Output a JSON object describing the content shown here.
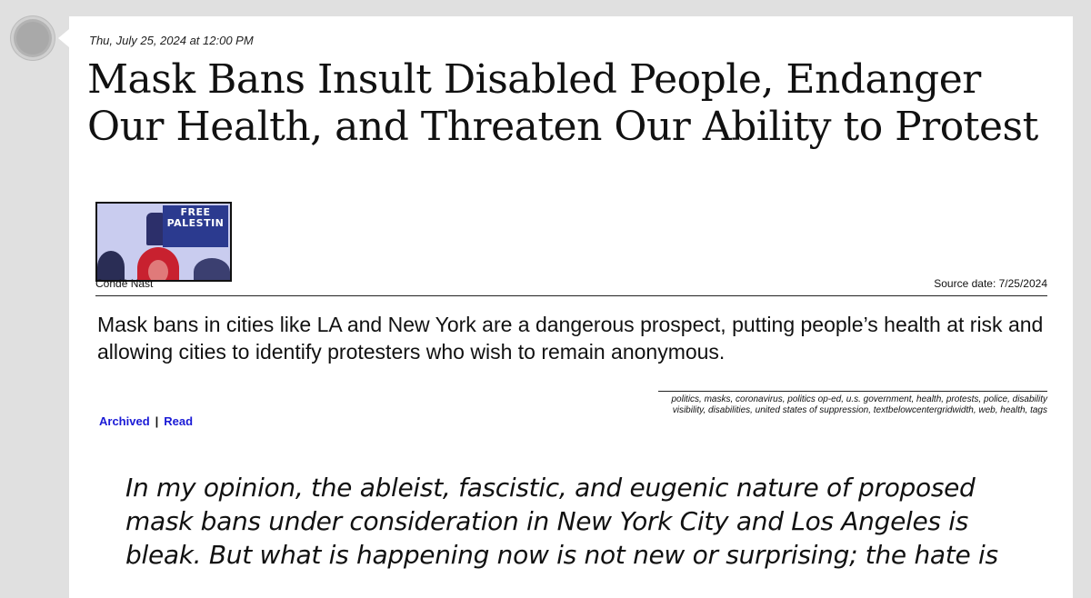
{
  "post": {
    "date": "Thu, July 25, 2024 at 12:00 PM",
    "title": "Mask Bans Insult Disabled People, Endanger Our Health, and Threaten Our Ability to Protest"
  },
  "thumbnail": {
    "sign_text": "FREE PALESTIN"
  },
  "meta": {
    "publisher": "Condé Nast",
    "source_date": "Source date: 7/25/2024"
  },
  "summary": "Mask bans in cities like LA and New York are a dangerous prospect, putting people’s health at risk and allowing cities to identify protesters who wish to remain anonymous.",
  "links": {
    "archived": "Archived",
    "separator": "|",
    "read": "Read"
  },
  "tags": "politics, masks, coronavirus, politics op-ed, u.s. government, health, protests, police, disability visibility, disabilities, united states of suppression, textbelowcentergridwidth, web, health, tags",
  "quote": "In my opinion, the ableist, fascistic, and eugenic nature of proposed mask bans under consideration in New York City and Los Angeles is bleak. But what is happening now is not new or surprising; the hate is",
  "colors": {
    "background": "#e0e0e0",
    "card": "#ffffff",
    "link": "#1a1ad6",
    "sign": "#2b3a8f"
  }
}
